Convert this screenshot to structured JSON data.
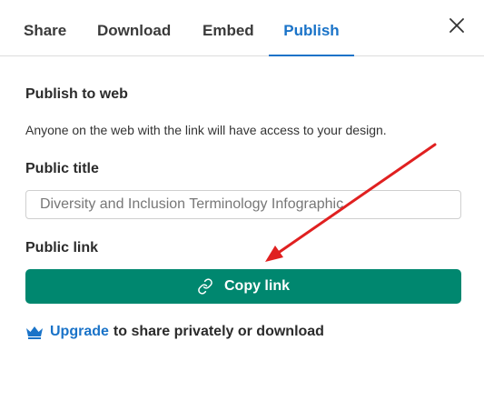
{
  "tabs": [
    {
      "label": "Share"
    },
    {
      "label": "Download"
    },
    {
      "label": "Embed"
    },
    {
      "label": "Publish",
      "active": true
    }
  ],
  "close_icon": "close-icon",
  "publish_section": {
    "heading": "Publish to web",
    "description": "Anyone on the web with the link will have access to your design."
  },
  "title_section": {
    "heading": "Public title",
    "value": "Diversity and Inclusion Terminology Infographic"
  },
  "link_section": {
    "heading": "Public link",
    "button_label": "Copy link",
    "button_icon": "link-icon"
  },
  "upgrade": {
    "icon": "crown-icon",
    "link_text": "Upgrade",
    "rest_text": "to share privately or download"
  },
  "colors": {
    "accent_blue": "#1a73c8",
    "button_green": "#00876f",
    "annotation_arrow": "#e02020"
  }
}
